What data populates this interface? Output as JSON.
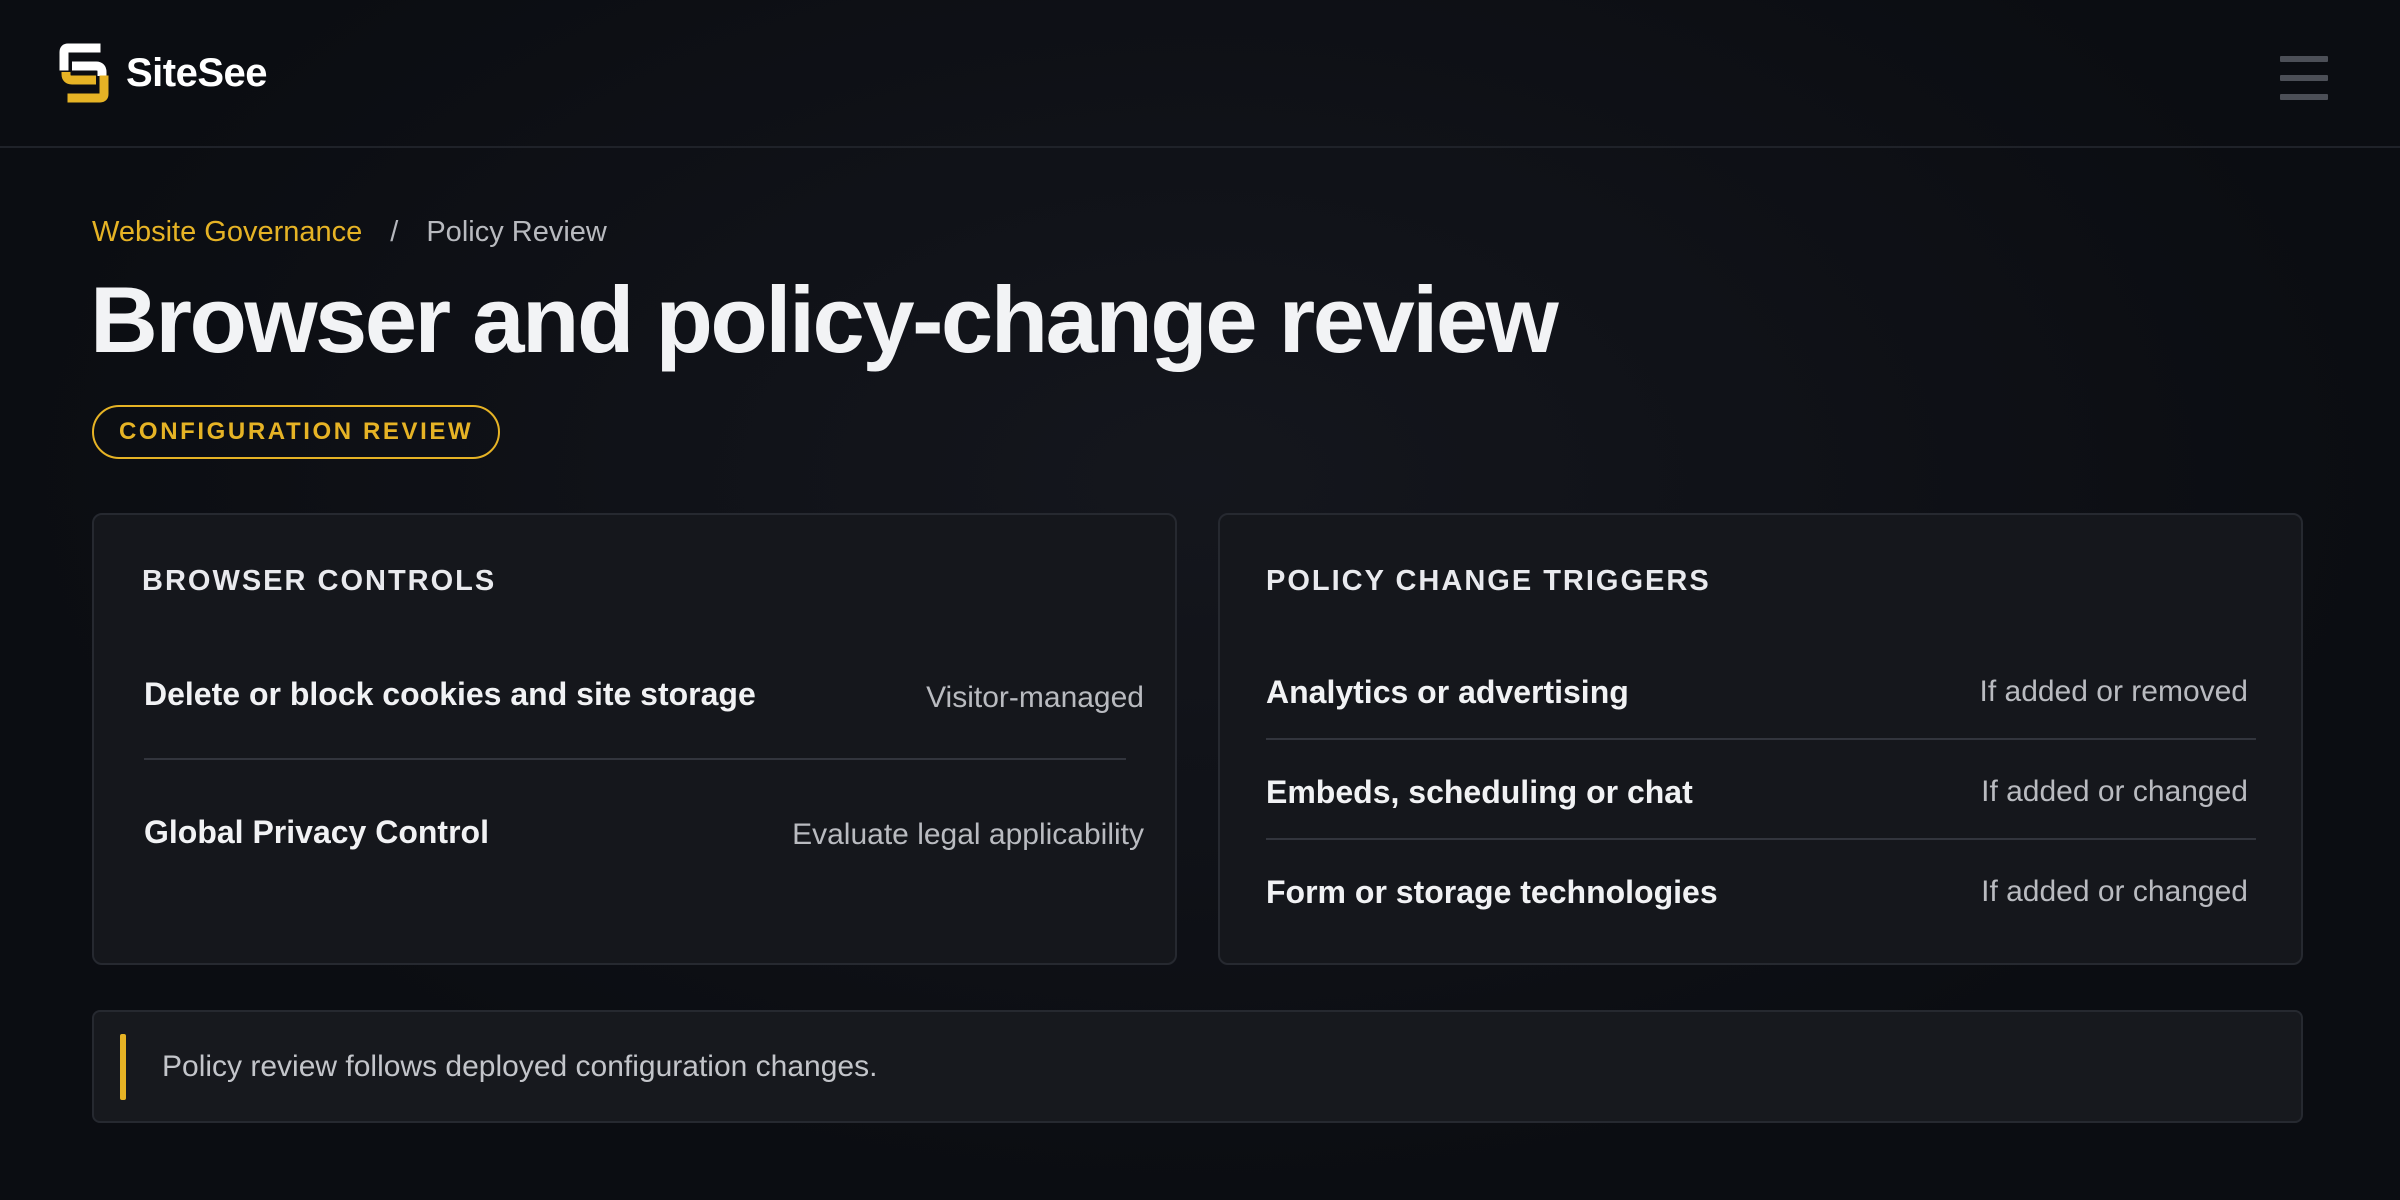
{
  "header": {
    "brand_name": "SiteSee",
    "logo_icon": "sitesee-logo-icon",
    "menu_icon": "hamburger-menu-icon"
  },
  "breadcrumb": {
    "parent": "Website Governance",
    "separator": "/",
    "current": "Policy Review"
  },
  "page": {
    "title": "Browser and policy-change review",
    "badge": "CONFIGURATION REVIEW"
  },
  "browser_controls": {
    "heading": "BROWSER CONTROLS",
    "rows": [
      {
        "label": "Delete or block cookies and site storage",
        "value": "Visitor-managed"
      },
      {
        "label": "Global Privacy Control",
        "value": "Evaluate legal applicability"
      }
    ]
  },
  "policy_triggers": {
    "heading": "POLICY CHANGE TRIGGERS",
    "rows": [
      {
        "label": "Analytics or advertising",
        "value": "If added or removed"
      },
      {
        "label": "Embeds, scheduling or chat",
        "value": "If added or changed"
      },
      {
        "label": "Form or storage technologies",
        "value": "If added or changed"
      }
    ]
  },
  "note": {
    "text": "Policy review follows deployed configuration changes."
  },
  "colors": {
    "accent": "#e6b325",
    "background": "#0b0d12",
    "card": "#15171c"
  }
}
